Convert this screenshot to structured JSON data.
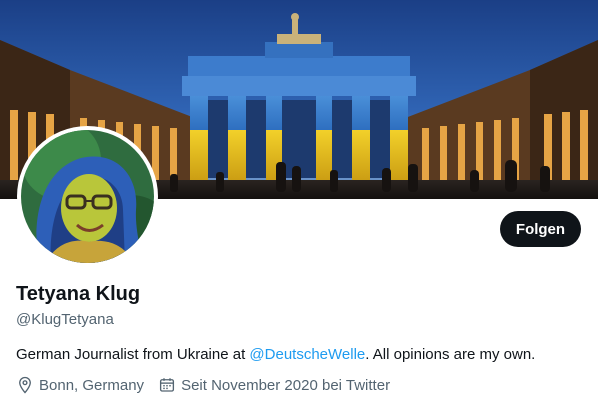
{
  "profile": {
    "name": "Tetyana Klug",
    "handle": "@KlugTetyana",
    "follow_label": "Folgen",
    "bio_prefix": "German Journalist from Ukraine at ",
    "bio_mention": "@DeutscheWelle",
    "bio_suffix": ". All opinions are my own.",
    "location": "Bonn, Germany",
    "joined": "Seit November 2020 bei Twitter"
  },
  "icons": {
    "location": "location-pin-icon",
    "joined": "calendar-icon"
  },
  "colors": {
    "primary_text": "#0f1419",
    "secondary_text": "#536471",
    "link": "#1d9bf0",
    "button_bg": "#0f1419",
    "flag_blue": "#3a7bd5",
    "flag_yellow": "#e8c21a"
  }
}
